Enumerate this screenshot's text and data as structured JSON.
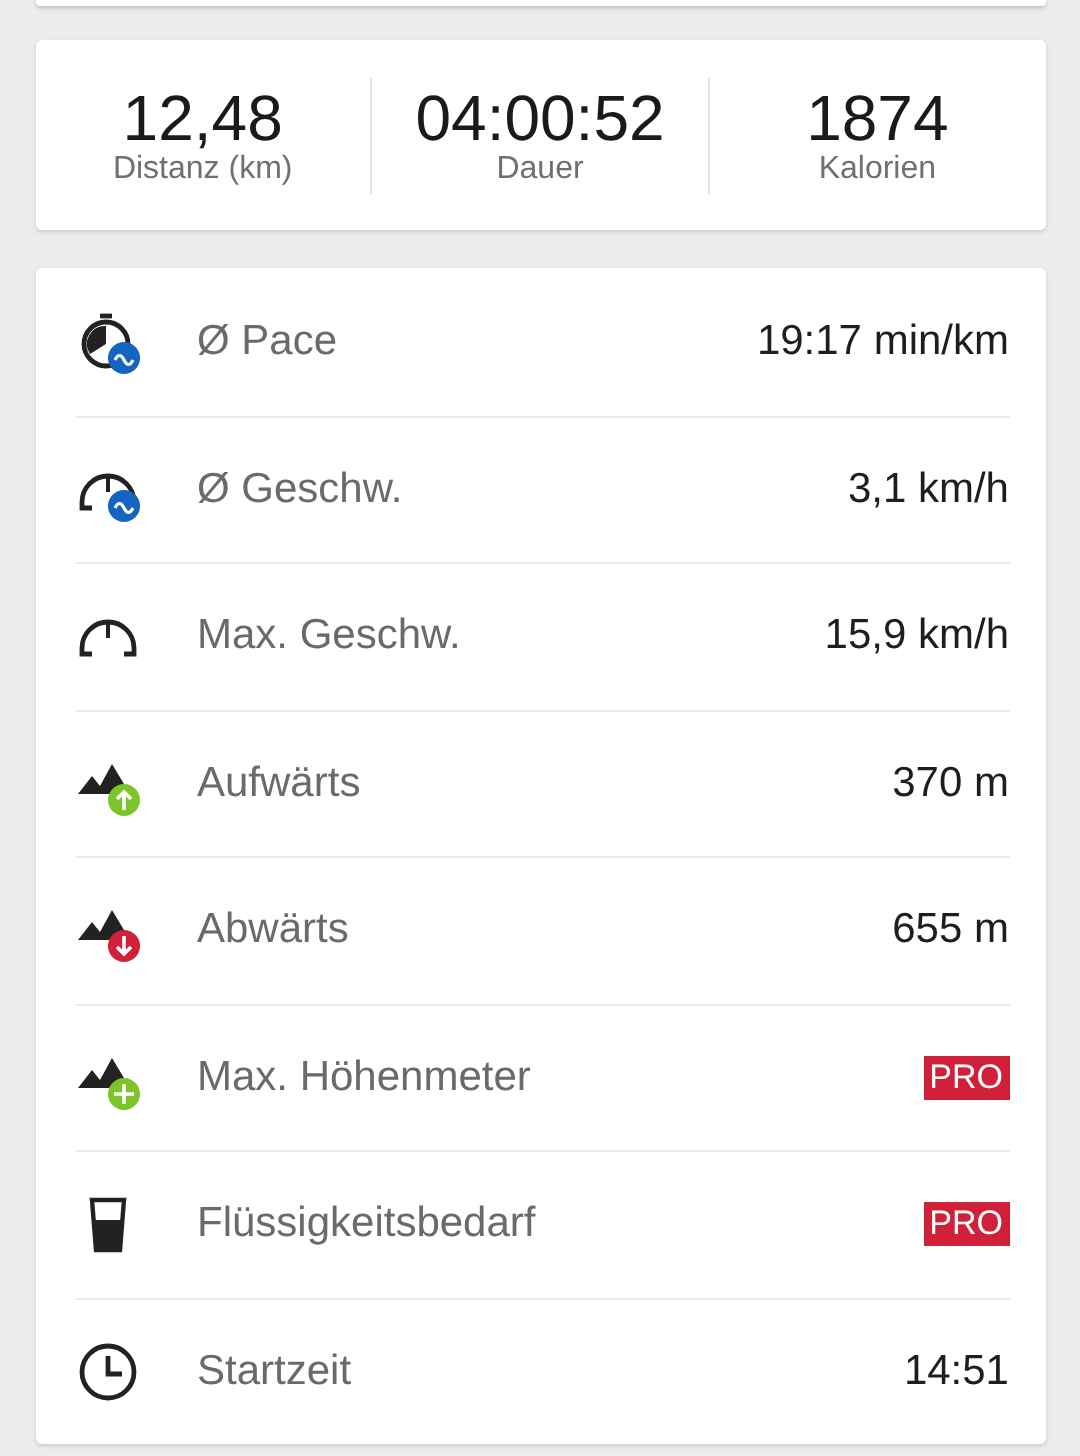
{
  "summary": [
    {
      "value": "12,48",
      "label": "Distanz (km)"
    },
    {
      "value": "04:00:52",
      "label": "Dauer"
    },
    {
      "value": "1874",
      "label": "Kalorien"
    }
  ],
  "stats": [
    {
      "label": "Ø Pace",
      "kind": "value",
      "value": "19:17 min/km"
    },
    {
      "label": "Ø Geschw.",
      "kind": "value",
      "value": "3,1 km/h"
    },
    {
      "label": "Max. Geschw.",
      "kind": "value",
      "value": "15,9 km/h"
    },
    {
      "label": "Aufwärts",
      "kind": "value",
      "value": "370 m"
    },
    {
      "label": "Abwärts",
      "kind": "value",
      "value": "655 m"
    },
    {
      "label": "Max. Höhenmeter",
      "kind": "badge",
      "value": "PRO"
    },
    {
      "label": "Flüssigkeitsbedarf",
      "kind": "badge",
      "value": "PRO"
    },
    {
      "label": "Startzeit",
      "kind": "value",
      "value": "14:51"
    }
  ]
}
